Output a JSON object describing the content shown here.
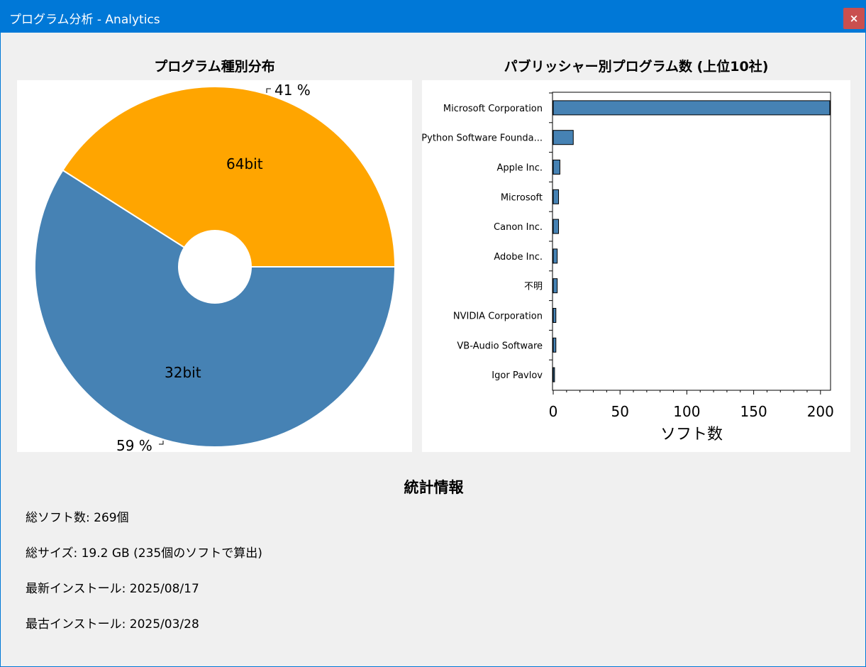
{
  "window": {
    "title": "プログラム分析 - Analytics",
    "close_label": "×"
  },
  "pie_panel": {
    "title": "プログラム種別分布"
  },
  "bar_panel": {
    "title": "パブリッシャー別プログラム数 (上位10社)"
  },
  "stats": {
    "title": "統計情報",
    "total_count": "総ソフト数: 269個",
    "total_size": "総サイズ: 19.2 GB (235個のソフトで算出)",
    "latest_install": "最新インストール: 2025/08/17",
    "oldest_install": "最古インストール: 2025/03/28"
  },
  "chart_data": [
    {
      "type": "pie",
      "title": "プログラム種別分布",
      "categories": [
        "32bit",
        "64bit"
      ],
      "values": [
        59,
        41
      ],
      "value_labels": [
        "59 %",
        "41 %"
      ],
      "colors": [
        "#4682b4",
        "#ffa500"
      ],
      "donut_hole": true
    },
    {
      "type": "bar",
      "orientation": "horizontal",
      "title": "パブリッシャー別プログラム数 (上位10社)",
      "categories": [
        "Microsoft Corporation",
        "Python Software Founda...",
        "Apple Inc.",
        "Microsoft",
        "Canon Inc.",
        "Adobe Inc.",
        "不明",
        "NVIDIA Corporation",
        "VB-Audio Software",
        "Igor Pavlov"
      ],
      "values": [
        207,
        15,
        5,
        4,
        4,
        3,
        3,
        2,
        2,
        1
      ],
      "xlabel": "ソフト数",
      "xlim": [
        0,
        207
      ],
      "xticks": [
        "0",
        "50",
        "100",
        "150",
        "200"
      ],
      "bar_color": "#4682b4"
    }
  ]
}
